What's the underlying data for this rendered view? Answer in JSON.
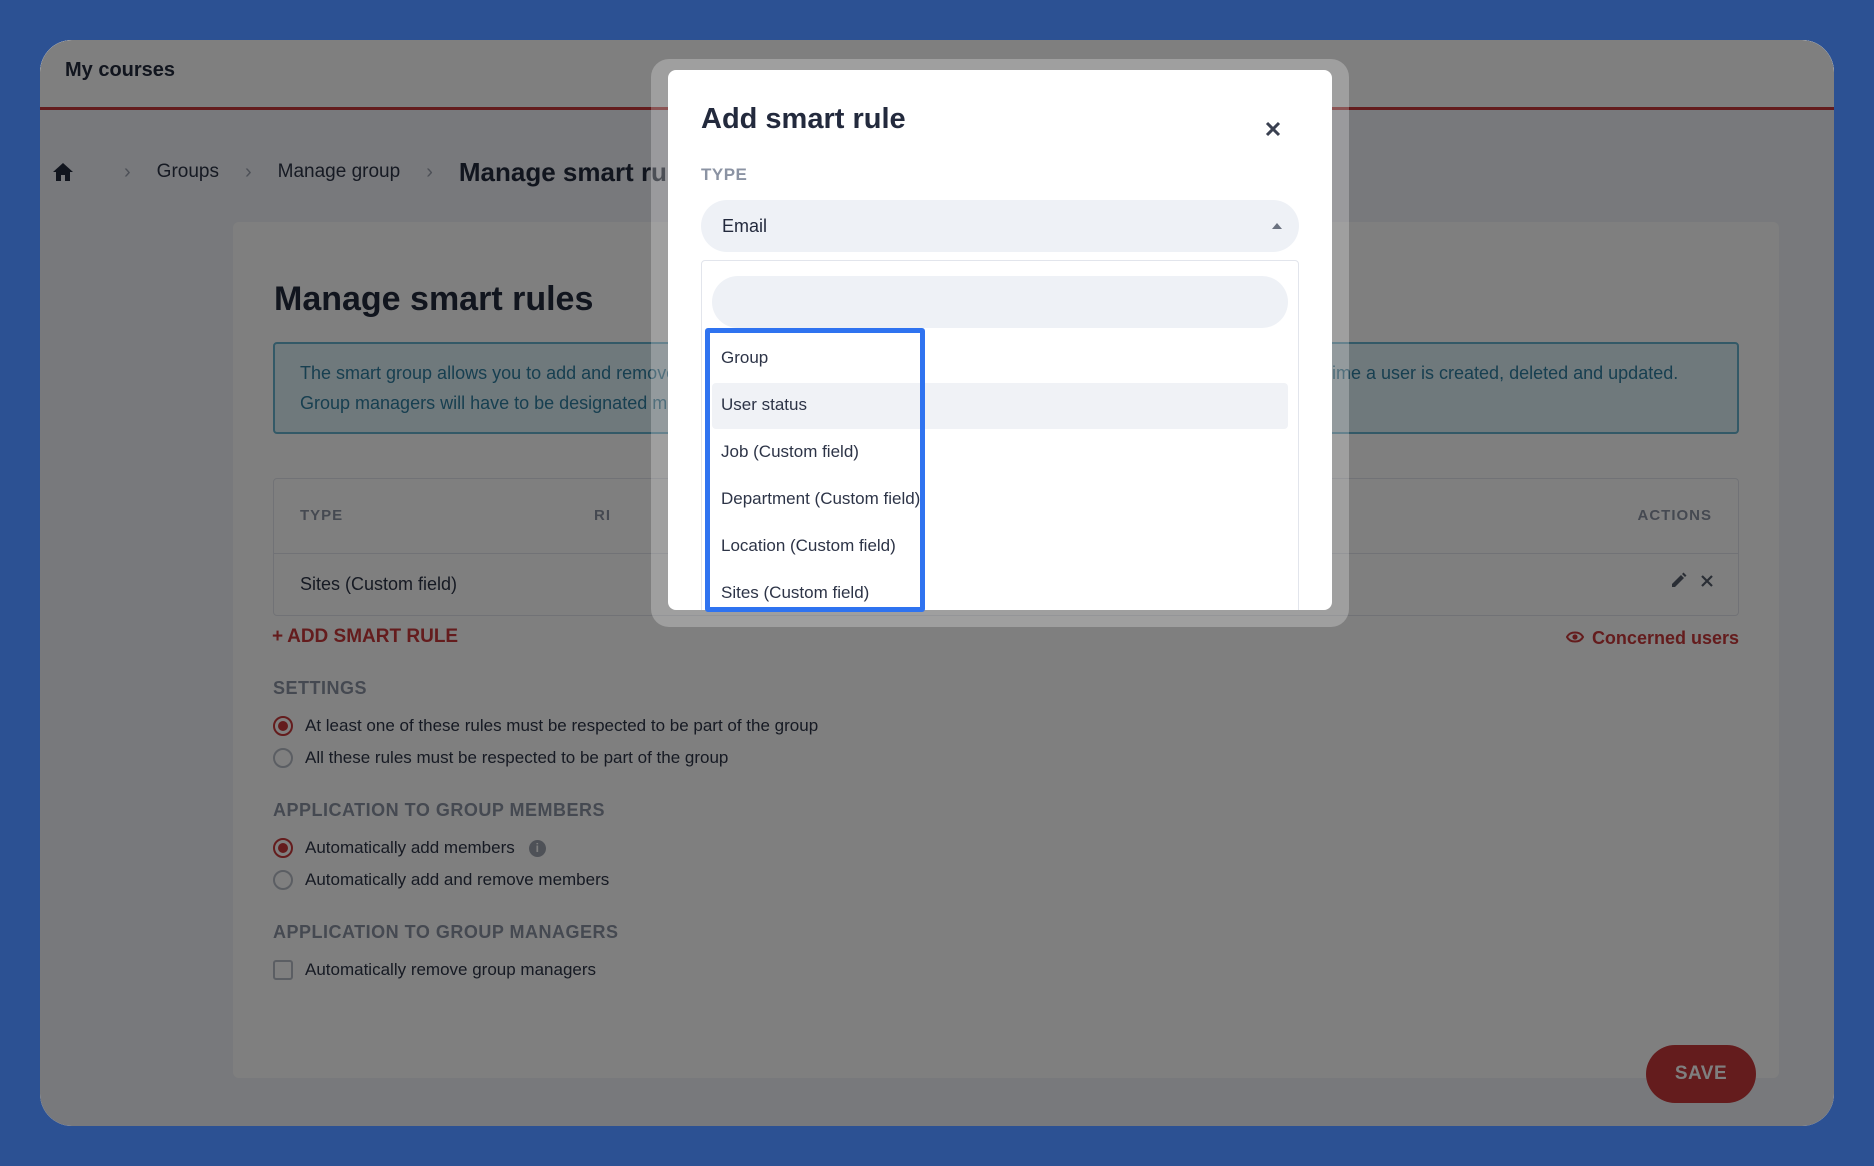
{
  "topbar": {
    "brand": "My courses"
  },
  "breadcrumb": {
    "items": [
      "Groups",
      "Manage group"
    ],
    "current": "Manage smart rules"
  },
  "page": {
    "title": "Manage smart rules",
    "info_line1_left": "The smart group allows you to add and remove",
    "info_line1_right": "time a user is created, deleted and updated.",
    "info_line2": "Group managers will have to be designated ma"
  },
  "table": {
    "headers": {
      "type": "TYPE",
      "rule": "RI",
      "actions": "ACTIONS"
    },
    "rows": [
      {
        "type": "Sites (Custom field)"
      }
    ]
  },
  "actions": {
    "add_rule": "ADD SMART RULE",
    "concerned_users": "Concerned users",
    "save": "SAVE"
  },
  "settings": {
    "label": "SETTINGS",
    "options": [
      {
        "label": "At least one of these rules must be respected to be part of the group",
        "selected": true
      },
      {
        "label": "All these rules must be respected to be part of the group",
        "selected": false
      }
    ]
  },
  "members": {
    "label": "APPLICATION TO GROUP MEMBERS",
    "options": [
      {
        "label": "Automatically add members",
        "selected": true
      },
      {
        "label": "Automatically add and remove members",
        "selected": false
      }
    ]
  },
  "managers": {
    "label": "APPLICATION TO GROUP MANAGERS",
    "options": [
      {
        "label": "Automatically remove group managers",
        "checked": false
      }
    ]
  },
  "modal": {
    "title": "Add smart rule",
    "type_label": "TYPE",
    "selected_type": "Email",
    "search_value": "",
    "options": [
      "Group",
      "User status",
      "Job (Custom field)",
      "Department (Custom field)",
      "Location (Custom field)",
      "Sites (Custom field)"
    ],
    "hovered_option": "User status"
  },
  "colors": {
    "background": "#2c5193",
    "accent_red": "#c9393b",
    "highlight_blue": "#2f73f0",
    "info_text": "#2f7ea1"
  }
}
